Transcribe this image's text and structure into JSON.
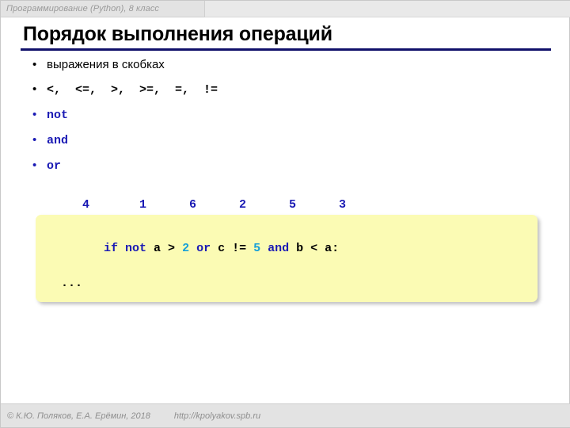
{
  "header": {
    "course_label": "Программирование (Python), 8 класс"
  },
  "title": "Порядок выполнения операций",
  "bullets": [
    {
      "text": "выражения в скобках",
      "style": "plain",
      "bullet_color": "#000000"
    },
    {
      "text": "<,  <=,  >,  >=,  =,  !=",
      "style": "mono-black",
      "bullet_color": "#000000"
    },
    {
      "text": "not",
      "style": "mono-blue",
      "bullet_color": "#1a1ab4"
    },
    {
      "text": "and",
      "style": "mono-blue",
      "bullet_color": "#1a1ab4"
    },
    {
      "text": "or",
      "style": "mono-blue",
      "bullet_color": "#1a1ab4"
    }
  ],
  "bullet_glyph": "•",
  "code": {
    "order_numbers_line": "     4       1      6      2      5      3",
    "order_numbers": [
      "4",
      "1",
      "6",
      "2",
      "5",
      "3"
    ],
    "line1": {
      "tokens": [
        {
          "t": "if ",
          "c": "kw"
        },
        {
          "t": "not ",
          "c": "kw"
        },
        {
          "t": "a > ",
          "c": "pl"
        },
        {
          "t": "2",
          "c": "num"
        },
        {
          "t": " ",
          "c": "pl"
        },
        {
          "t": "or ",
          "c": "kw"
        },
        {
          "t": "c != ",
          "c": "pl"
        },
        {
          "t": "5",
          "c": "num"
        },
        {
          "t": " ",
          "c": "pl"
        },
        {
          "t": "and ",
          "c": "kw"
        },
        {
          "t": "b < a:",
          "c": "pl"
        }
      ]
    },
    "line2": "  ..."
  },
  "footer": {
    "copyright": "© К.Ю. Поляков, Е.А. Ерёмин, 2018",
    "url": "http://kpolyakov.spb.ru"
  },
  "colors": {
    "rule": "#10106a",
    "keyword": "#1a1ab4",
    "number": "#17a0d8",
    "code_bg": "#fbfbb4",
    "chrome": "#e3e3e3",
    "muted_text": "#8f8f8f"
  }
}
